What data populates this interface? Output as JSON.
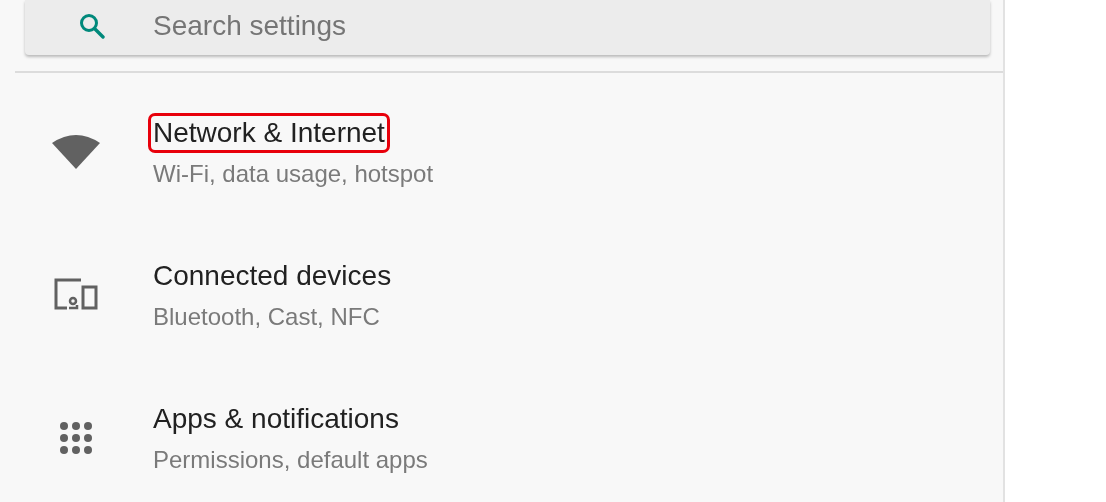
{
  "search": {
    "placeholder": "Search settings"
  },
  "items": [
    {
      "kind": "wifi",
      "title": "Network & Internet",
      "subtitle": "Wi-Fi, data usage, hotspot",
      "highlighted": true
    },
    {
      "kind": "devices",
      "title": "Connected devices",
      "subtitle": "Bluetooth, Cast, NFC",
      "highlighted": false
    },
    {
      "kind": "apps",
      "title": "Apps & notifications",
      "subtitle": "Permissions, default apps",
      "highlighted": false
    }
  ]
}
